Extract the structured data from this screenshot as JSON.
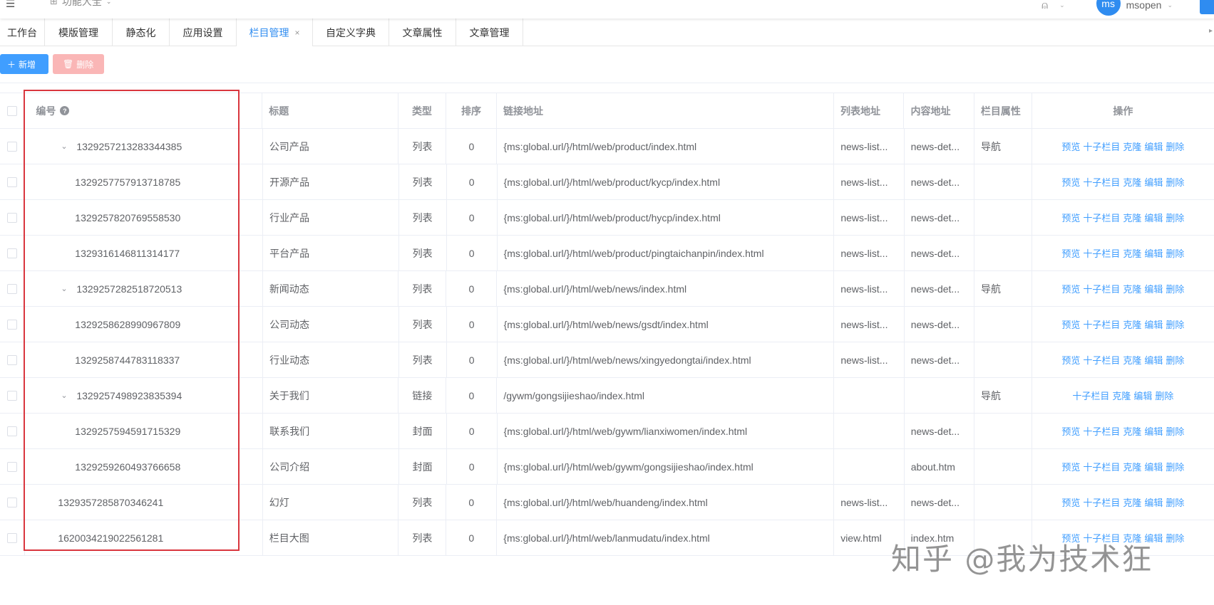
{
  "header": {
    "menu_icon": "menu-icon",
    "app_switch_label": "功能大全",
    "avatar_text": "ms",
    "username": "msopen"
  },
  "tabs": [
    {
      "label": "工作台",
      "active": false
    },
    {
      "label": "模版管理",
      "active": false
    },
    {
      "label": "静态化",
      "active": false
    },
    {
      "label": "应用设置",
      "active": false
    },
    {
      "label": "栏目管理",
      "active": true,
      "closable": true
    },
    {
      "label": "自定义字典",
      "active": false
    },
    {
      "label": "文章属性",
      "active": false
    },
    {
      "label": "文章管理",
      "active": false
    }
  ],
  "toolbar": {
    "add_label": "新增",
    "delete_label": "删除"
  },
  "table": {
    "columns": {
      "id": "编号",
      "title": "标题",
      "type": "类型",
      "sort": "排序",
      "url": "链接地址",
      "list_url": "列表地址",
      "content_url": "内容地址",
      "attr": "栏目属性",
      "ops": "操作"
    },
    "rows": [
      {
        "id": "1329257213283344385",
        "title": "公司产品",
        "type": "列表",
        "sort": "0",
        "url": "{ms:global.url/}/html/web/product/index.html",
        "list_url": "news-list...",
        "content_url": "news-det...",
        "attr": "导航"
      },
      {
        "id": "1329257757913718785",
        "title": "开源产品",
        "type": "列表",
        "sort": "0",
        "url": "{ms:global.url/}/html/web/product/kycp/index.html",
        "list_url": "news-list...",
        "content_url": "news-det...",
        "attr": ""
      },
      {
        "id": "1329257820769558530",
        "title": "行业产品",
        "type": "列表",
        "sort": "0",
        "url": "{ms:global.url/}/html/web/product/hycp/index.html",
        "list_url": "news-list...",
        "content_url": "news-det...",
        "attr": ""
      },
      {
        "id": "1329316146811314177",
        "title": "平台产品",
        "type": "列表",
        "sort": "0",
        "url": "{ms:global.url/}/html/web/product/pingtaichanpin/index.html",
        "list_url": "news-list...",
        "content_url": "news-det...",
        "attr": ""
      },
      {
        "id": "1329257282518720513",
        "title": "新闻动态",
        "type": "列表",
        "sort": "0",
        "url": "{ms:global.url/}/html/web/news/index.html",
        "list_url": "news-list...",
        "content_url": "news-det...",
        "attr": "导航"
      },
      {
        "id": "1329258628990967809",
        "title": "公司动态",
        "type": "列表",
        "sort": "0",
        "url": "{ms:global.url/}/html/web/news/gsdt/index.html",
        "list_url": "news-list...",
        "content_url": "news-det...",
        "attr": ""
      },
      {
        "id": "1329258744783118337",
        "title": "行业动态",
        "type": "列表",
        "sort": "0",
        "url": "{ms:global.url/}/html/web/news/xingyedongtai/index.html",
        "list_url": "news-list...",
        "content_url": "news-det...",
        "attr": ""
      },
      {
        "id": "1329257498923835394",
        "title": "关于我们",
        "type": "链接",
        "sort": "0",
        "url": "/gywm/gongsijieshao/index.html",
        "list_url": "",
        "content_url": "",
        "attr": "导航"
      },
      {
        "id": "1329257594591715329",
        "title": "联系我们",
        "type": "封面",
        "sort": "0",
        "url": "{ms:global.url/}/html/web/gywm/lianxiwomen/index.html",
        "list_url": "",
        "content_url": "news-det...",
        "attr": ""
      },
      {
        "id": "1329259260493766658",
        "title": "公司介绍",
        "type": "封面",
        "sort": "0",
        "url": "{ms:global.url/}/html/web/gywm/gongsijieshao/index.html",
        "list_url": "",
        "content_url": "about.htm",
        "attr": ""
      },
      {
        "id": "1329357285870346241",
        "title": "幻灯",
        "type": "列表",
        "sort": "0",
        "url": "{ms:global.url/}/html/web/huandeng/index.html",
        "list_url": "news-list...",
        "content_url": "news-det...",
        "attr": ""
      },
      {
        "id": "1620034219022561281",
        "title": "栏目大图",
        "type": "列表",
        "sort": "0",
        "url": "{ms:global.url/}/html/web/lanmudatu/index.html",
        "list_url": "view.html",
        "content_url": "index.htm",
        "attr": ""
      }
    ],
    "ops_labels": {
      "preview": "预览",
      "add_child": "十子栏目",
      "clone": "克隆",
      "edit": "编辑",
      "delete": "删除"
    }
  },
  "watermark": "知乎 @我为技术狂",
  "colors": {
    "primary": "#409eff",
    "danger_light": "#fab6b6",
    "highlight_box": "#d9363e",
    "active_tab": "#2f8cf0"
  }
}
